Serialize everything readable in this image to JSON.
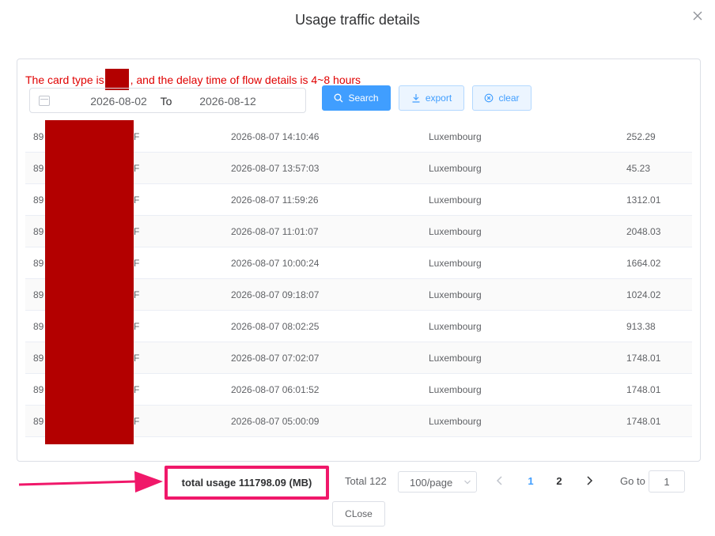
{
  "dialog": {
    "title": "Usage traffic details",
    "close_icon": "close-icon"
  },
  "notice": {
    "prefix": "The card type is",
    "suffix": ", and the delay time of flow details is 4~8 hours",
    "color": "#e00000"
  },
  "filters": {
    "start_date": "2026-08-02",
    "separator": "To",
    "end_date": "2026-08-12",
    "search_label": "Search",
    "export_label": "export",
    "clear_label": "clear"
  },
  "table": {
    "rows": [
      {
        "iccid_prefix": "89",
        "iccid_suffix": "F",
        "time": "2026-08-07 14:10:46",
        "country": "Luxembourg",
        "usage": "252.29"
      },
      {
        "iccid_prefix": "89",
        "iccid_suffix": "F",
        "time": "2026-08-07 13:57:03",
        "country": "Luxembourg",
        "usage": "45.23"
      },
      {
        "iccid_prefix": "89",
        "iccid_suffix": "F",
        "time": "2026-08-07 11:59:26",
        "country": "Luxembourg",
        "usage": "1312.01"
      },
      {
        "iccid_prefix": "89",
        "iccid_suffix": "F",
        "time": "2026-08-07 11:01:07",
        "country": "Luxembourg",
        "usage": "2048.03"
      },
      {
        "iccid_prefix": "89",
        "iccid_suffix": "F",
        "time": "2026-08-07 10:00:24",
        "country": "Luxembourg",
        "usage": "1664.02"
      },
      {
        "iccid_prefix": "89",
        "iccid_suffix": "F",
        "time": "2026-08-07 09:18:07",
        "country": "Luxembourg",
        "usage": "1024.02"
      },
      {
        "iccid_prefix": "89",
        "iccid_suffix": "F",
        "time": "2026-08-07 08:02:25",
        "country": "Luxembourg",
        "usage": "913.38"
      },
      {
        "iccid_prefix": "89",
        "iccid_suffix": "F",
        "time": "2026-08-07 07:02:07",
        "country": "Luxembourg",
        "usage": "1748.01"
      },
      {
        "iccid_prefix": "89",
        "iccid_suffix": "F",
        "time": "2026-08-07 06:01:52",
        "country": "Luxembourg",
        "usage": "1748.01"
      },
      {
        "iccid_prefix": "89",
        "iccid_suffix": "F",
        "time": "2026-08-07 05:00:09",
        "country": "Luxembourg",
        "usage": "1748.01"
      }
    ]
  },
  "footer": {
    "total_usage": "total usage 111798.09 (MB)",
    "highlight_color": "#f0186a"
  },
  "pagination": {
    "total": "Total 122",
    "page_size": "100/page",
    "pages": [
      "1",
      "2"
    ],
    "current_page": "1",
    "goto_label": "Go to",
    "goto_value": "1"
  },
  "actions": {
    "close_label": "CLose"
  },
  "colors": {
    "primary": "#409eff",
    "redaction": "#b30000"
  }
}
